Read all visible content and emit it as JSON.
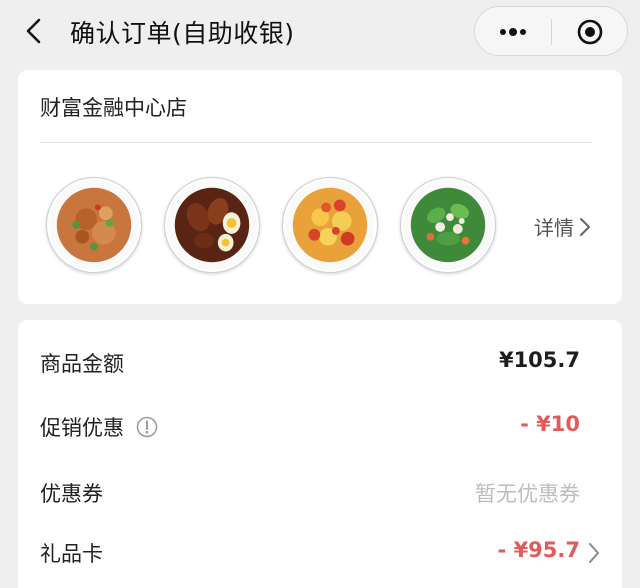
{
  "nav": {
    "title": "确认订单(自助收银)",
    "back_icon": "chevron-left-icon",
    "more_icon": "more-dots-icon",
    "close_icon": "target-circle-icon"
  },
  "store": {
    "name": "财富金融中心店",
    "detail_label": "详情",
    "dishes": [
      {
        "name": "stir-fried-pork-dish"
      },
      {
        "name": "braised-drumsticks-eggs-dish"
      },
      {
        "name": "tomato-egg-dish"
      },
      {
        "name": "greens-mushroom-dish"
      }
    ]
  },
  "price": {
    "rows": [
      {
        "label": "商品金额",
        "value": "¥105.7",
        "style": "dark"
      },
      {
        "label": "促销优惠",
        "value": "- ¥10",
        "style": "red",
        "info_icon": "info-circle-icon"
      },
      {
        "label": "优惠券",
        "value": "暂无优惠券",
        "style": "muted"
      },
      {
        "label": "礼品卡",
        "value": "- ¥95.7",
        "style": "red",
        "chevron_icon": "chevron-right-icon"
      }
    ]
  },
  "colors": {
    "background": "#efefef",
    "card": "#ffffff",
    "discount_red": "#e35a5a",
    "muted": "#bdbdbd"
  }
}
